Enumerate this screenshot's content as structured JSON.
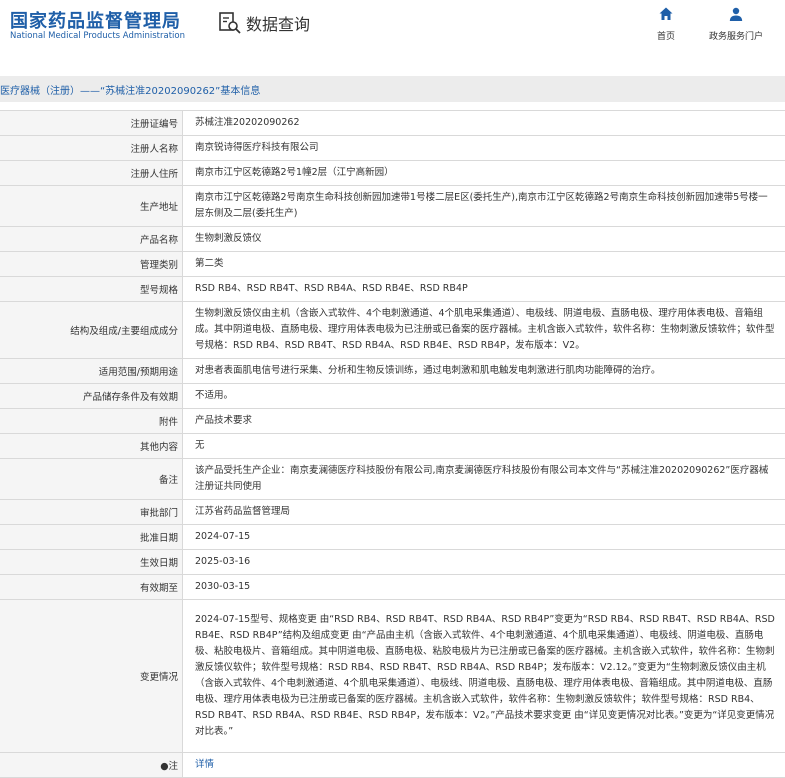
{
  "header": {
    "org_cn": "国家药品监督管理局",
    "org_en": "National Medical Products Administration",
    "section_title": "数据查询",
    "nav": [
      {
        "icon": "home-icon",
        "label": "首页"
      },
      {
        "icon": "user-icon",
        "label": "政务服务门户"
      }
    ]
  },
  "breadcrumb": "医疗器械（注册）——“苏械注准20202090262”基本信息",
  "rows": [
    {
      "label": "注册证编号",
      "value": "苏械注准20202090262"
    },
    {
      "label": "注册人名称",
      "value": "南京锐诗得医疗科技有限公司"
    },
    {
      "label": "注册人住所",
      "value": "南京市江宁区乾德路2号1幢2层（江宁高新园）"
    },
    {
      "label": "生产地址",
      "value": "南京市江宁区乾德路2号南京生命科技创新园加速带1号楼二层E区(委托生产),南京市江宁区乾德路2号南京生命科技创新园加速带5号楼一层东侧及二层(委托生产)"
    },
    {
      "label": "产品名称",
      "value": "生物刺激反馈仪"
    },
    {
      "label": "管理类别",
      "value": "第二类"
    },
    {
      "label": "型号规格",
      "value": "RSD RB4、RSD RB4T、RSD RB4A、RSD RB4E、RSD RB4P"
    },
    {
      "label": "结构及组成/主要组成成分",
      "value": "生物刺激反馈仪由主机（含嵌入式软件、4个电刺激通道、4个肌电采集通道）、电极线、阴道电极、直肠电极、理疗用体表电极、音箱组成。其中阴道电极、直肠电极、理疗用体表电极为已注册或已备案的医疗器械。主机含嵌入式软件，软件名称：生物刺激反馈软件；软件型号规格：RSD RB4、RSD RB4T、RSD RB4A、RSD RB4E、RSD RB4P，发布版本：V2。"
    },
    {
      "label": "适用范围/预期用途",
      "value": "对患者表面肌电信号进行采集、分析和生物反馈训练，通过电刺激和肌电触发电刺激进行肌肉功能障碍的治疗。"
    },
    {
      "label": "产品储存条件及有效期",
      "value": "不适用。"
    },
    {
      "label": "附件",
      "value": "产品技术要求"
    },
    {
      "label": "其他内容",
      "value": "无"
    },
    {
      "label": "备注",
      "value": "该产品受托生产企业：南京麦澜德医疗科技股份有限公司,南京麦澜德医疗科技股份有限公司本文件与“苏械注准20202090262”医疗器械注册证共同使用"
    },
    {
      "label": "审批部门",
      "value": "江苏省药品监督管理局"
    },
    {
      "label": "批准日期",
      "value": "2024-07-15"
    },
    {
      "label": "生效日期",
      "value": "2025-03-16"
    },
    {
      "label": "有效期至",
      "value": "2030-03-15"
    },
    {
      "label": "变更情况",
      "value": "2024-07-15型号、规格变更 由“RSD RB4、RSD RB4T、RSD RB4A、RSD RB4P”变更为“RSD RB4、RSD RB4T、RSD RB4A、RSD RB4E、RSD RB4P”结构及组成变更 由“产品由主机（含嵌入式软件、4个电刺激通道、4个肌电采集通道）、电极线、阴道电极、直肠电极、粘胶电极片、音箱组成。其中阴道电极、直肠电极、粘胶电极片为已注册或已备案的医疗器械。主机含嵌入式软件，软件名称：生物刺激反馈仪软件；软件型号规格：RSD RB4、RSD RB4T、RSD RB4A、RSD RB4P；发布版本：V2.12。”变更为“生物刺激反馈仪由主机（含嵌入式软件、4个电刺激通道、4个肌电采集通道）、电极线、阴道电极、直肠电极、理疗用体表电极、音箱组成。其中阴道电极、直肠电极、理疗用体表电极为已注册或已备案的医疗器械。主机含嵌入式软件，软件名称：生物刺激反馈软件；软件型号规格：RSD RB4、RSD RB4T、RSD RB4A、RSD RB4E、RSD RB4P，发布版本：V2。”产品技术要求变更 由“详见变更情况对比表。”变更为“详见变更情况对比表。”"
    },
    {
      "label": "●注",
      "value": "详情",
      "link": true
    }
  ]
}
